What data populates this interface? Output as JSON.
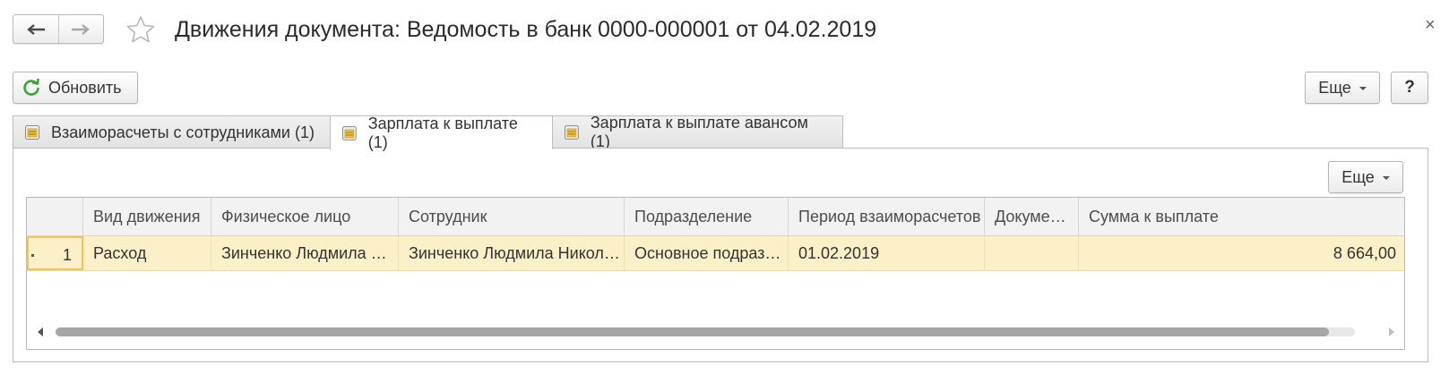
{
  "header": {
    "title": "Движения документа: Ведомость в банк 0000-000001 от 04.02.2019",
    "back_icon": "arrow-left-icon",
    "forward_icon": "arrow-right-icon",
    "favorite_icon": "star-icon",
    "close_label": "×"
  },
  "toolbar": {
    "refresh_label": "Обновить",
    "more_label": "Еще",
    "help_label": "?"
  },
  "tabs": [
    {
      "label": "Взаиморасчеты с сотрудниками (1)",
      "icon": "register-icon",
      "active": false
    },
    {
      "label": "Зарплата к выплате (1)",
      "icon": "register-icon",
      "active": true
    },
    {
      "label": "Зарплата к выплате авансом (1)",
      "icon": "register-icon",
      "active": false
    }
  ],
  "panel": {
    "more_label": "Еще"
  },
  "table": {
    "columns": [
      "",
      "Вид движения",
      "Физическое лицо",
      "Сотрудник",
      "Подразделение",
      "Период взаиморасчетов",
      "Докуме…",
      "Сумма к выплате"
    ],
    "rows": [
      [
        "1",
        "Расход",
        "Зинченко Людмила …",
        "Зинченко Людмила Никол…",
        "Основное подраз…",
        "01.02.2019",
        "",
        "8 664,00"
      ]
    ],
    "scroll_position": 0.98
  },
  "colors": {
    "accent_green": "#3aa635",
    "selected_row": "#fbf0c8",
    "selected_cell_border": "#f2c35b"
  }
}
